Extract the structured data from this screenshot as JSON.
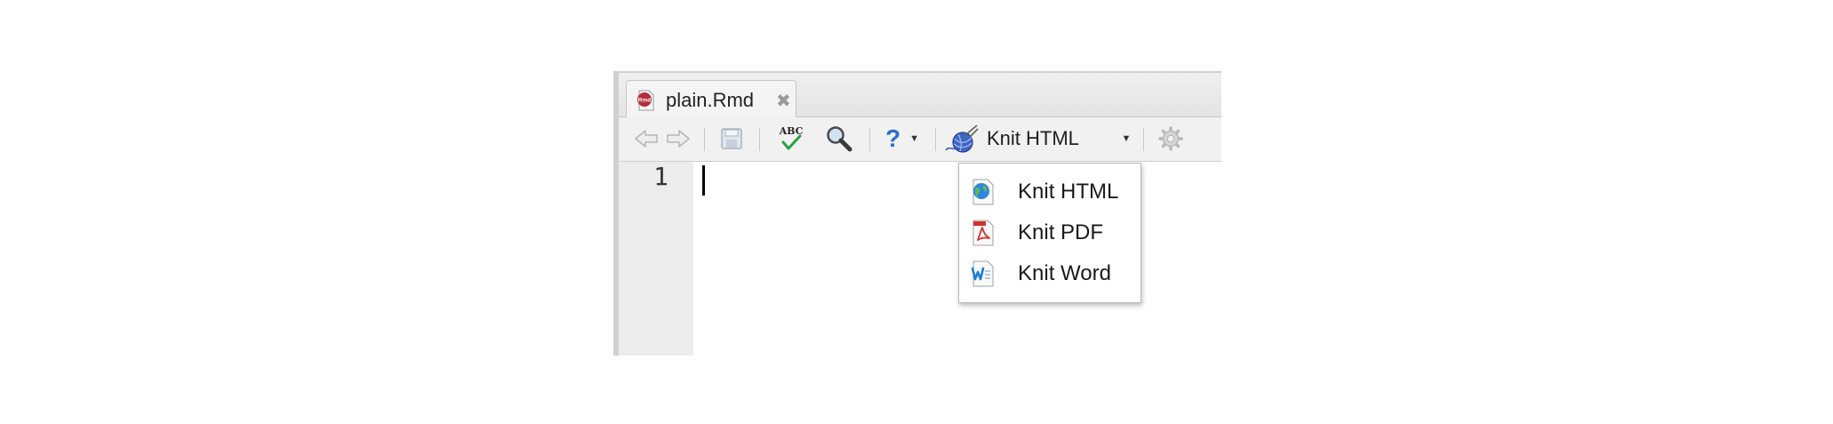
{
  "tab": {
    "filename": "plain.Rmd",
    "close_glyph": "✖",
    "icon": "rmd-file-icon"
  },
  "toolbar": {
    "back_icon": "arrow-left-icon",
    "forward_icon": "arrow-right-icon",
    "save_icon": "floppy-disk-icon",
    "spellcheck_icon": "spellcheck-icon",
    "find_icon": "magnifier-icon",
    "help_glyph": "?",
    "dropdown_glyph": "▼",
    "knit_label": "Knit HTML",
    "knit_icon": "yarn-ball-icon",
    "settings_icon": "gear-icon"
  },
  "editor": {
    "line_numbers": [
      "1"
    ]
  },
  "knit_menu": {
    "items": [
      {
        "label": "Knit HTML",
        "icon": "html-document-icon"
      },
      {
        "label": "Knit PDF",
        "icon": "pdf-document-icon"
      },
      {
        "label": "Knit Word",
        "icon": "word-document-icon"
      }
    ]
  },
  "colors": {
    "help_blue": "#2a6fc9",
    "spell_green": "#2ea043",
    "rmd_red": "#b32d3a",
    "pdf_red": "#d32f2f",
    "word_blue": "#1c7ed6"
  }
}
